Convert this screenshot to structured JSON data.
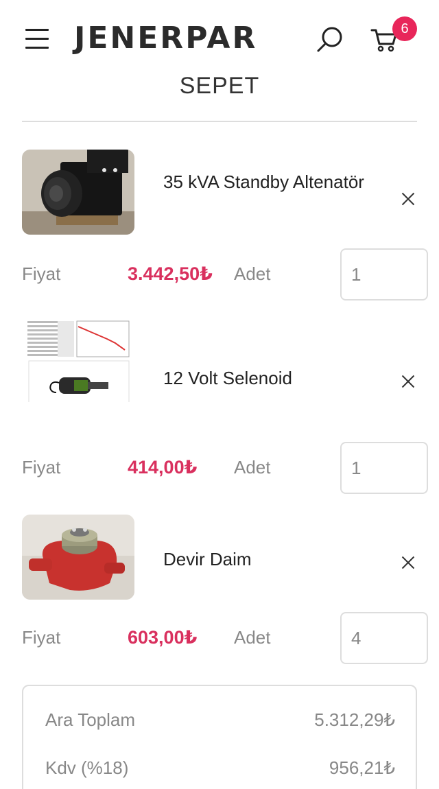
{
  "header": {
    "logo": "JENERPAR",
    "cart_count": "6"
  },
  "page": {
    "title": "SEPET"
  },
  "labels": {
    "price": "Fiyat",
    "quantity": "Adet"
  },
  "items": [
    {
      "name": "35 kVA Standby Altenatör",
      "price": "3.442,50₺",
      "quantity": "1"
    },
    {
      "name": "12 Volt Selenoid",
      "price": "414,00₺",
      "quantity": "1"
    },
    {
      "name": "Devir Daim",
      "price": "603,00₺",
      "quantity": "4"
    }
  ],
  "summary": {
    "subtotal_label": "Ara Toplam",
    "subtotal_value": "5.312,29₺",
    "tax_label": "Kdv (%18)",
    "tax_value": "956,21₺"
  },
  "colors": {
    "accent": "#e8265a",
    "price": "#d9305e"
  }
}
